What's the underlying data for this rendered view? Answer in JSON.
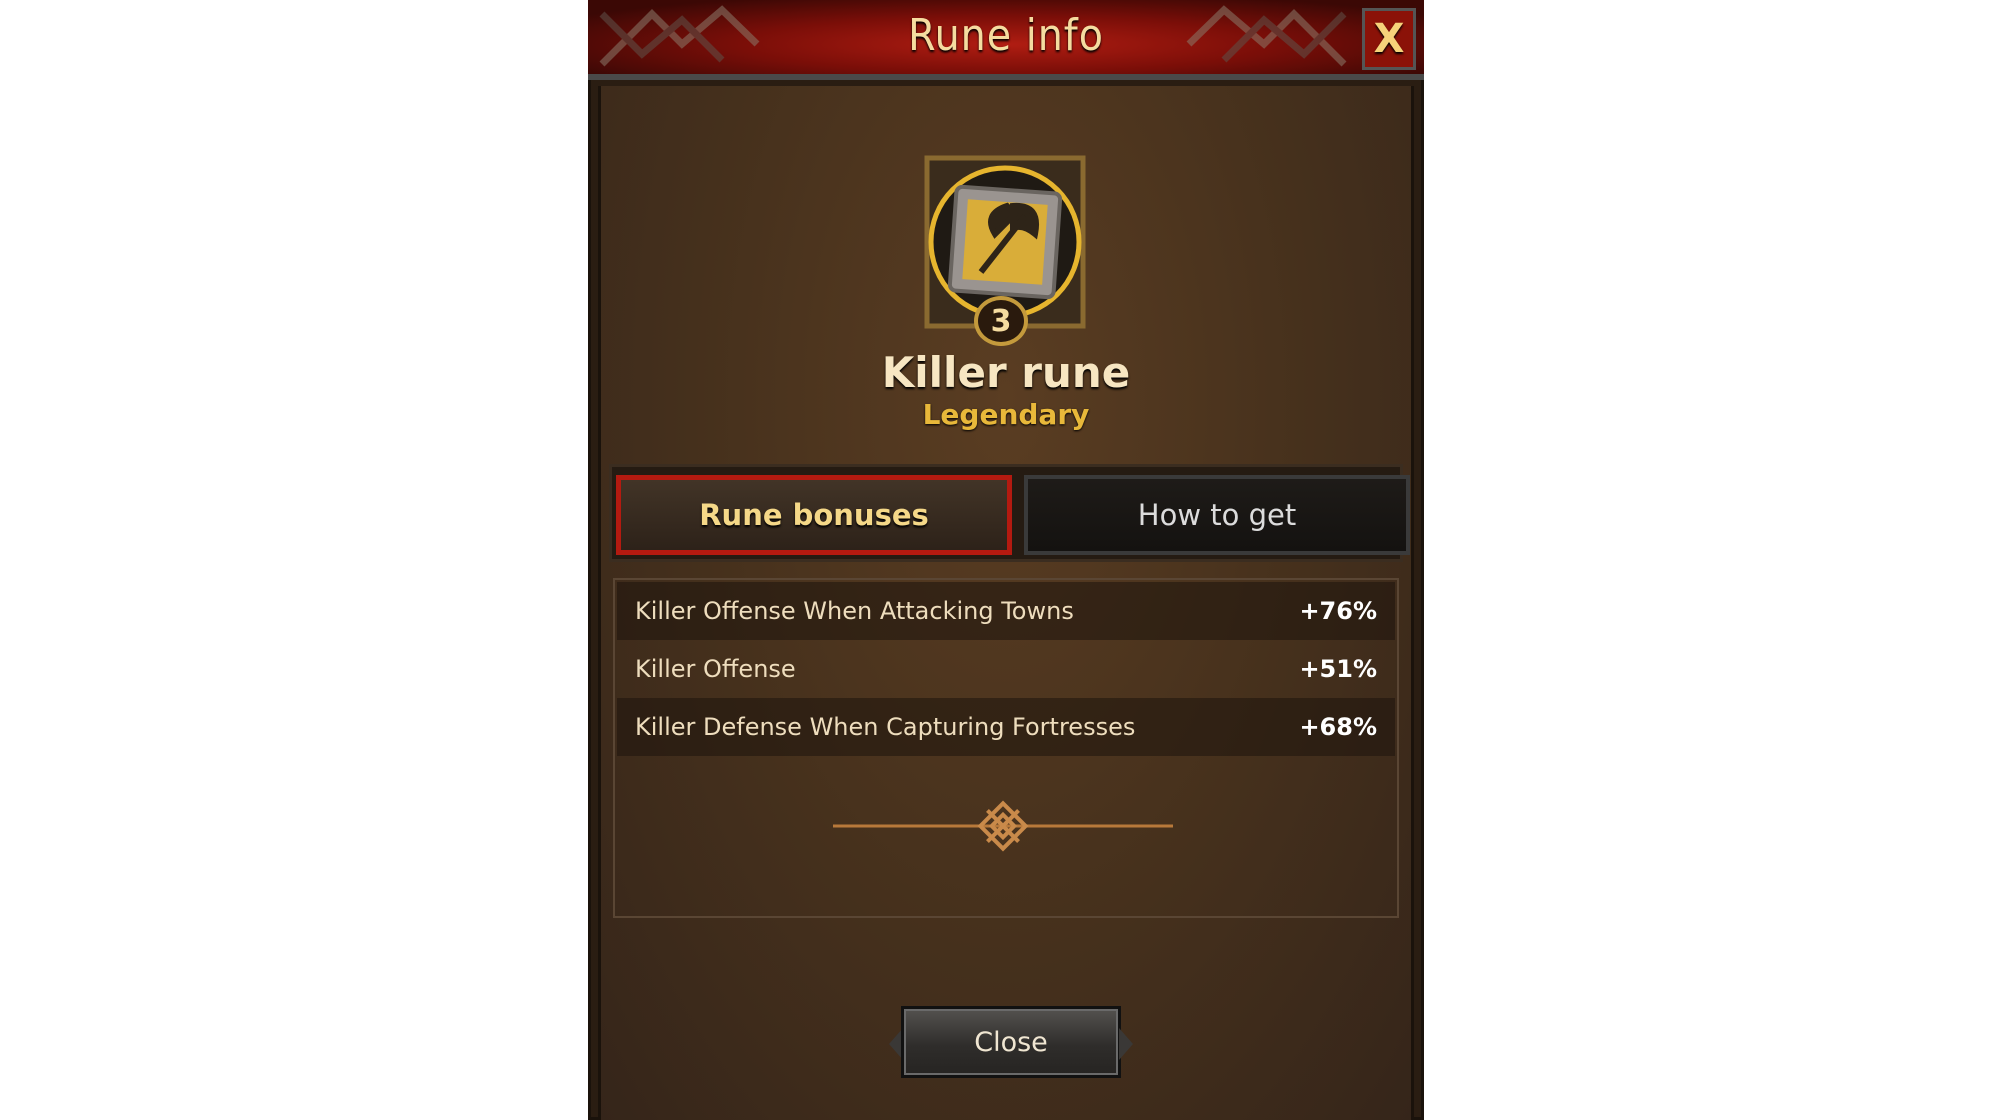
{
  "dialog": {
    "title": "Rune info",
    "close_x_label": "X"
  },
  "rune": {
    "name": "Killer rune",
    "rarity": "Legendary",
    "level": "3",
    "icon": "axe-rune-icon"
  },
  "tabs": [
    {
      "label": "Rune bonuses",
      "active": true
    },
    {
      "label": "How to get",
      "active": false
    }
  ],
  "bonuses": [
    {
      "name": "Killer Offense When Attacking Towns",
      "value": "+76%"
    },
    {
      "name": "Killer Offense",
      "value": "+51%"
    },
    {
      "name": "Killer Defense When Capturing Fortresses",
      "value": "+68%"
    }
  ],
  "footer": {
    "close_label": "Close"
  },
  "colors": {
    "header_red": "#b01d12",
    "accent_gold": "#e8b83a",
    "active_tab_border": "#b41a10"
  }
}
